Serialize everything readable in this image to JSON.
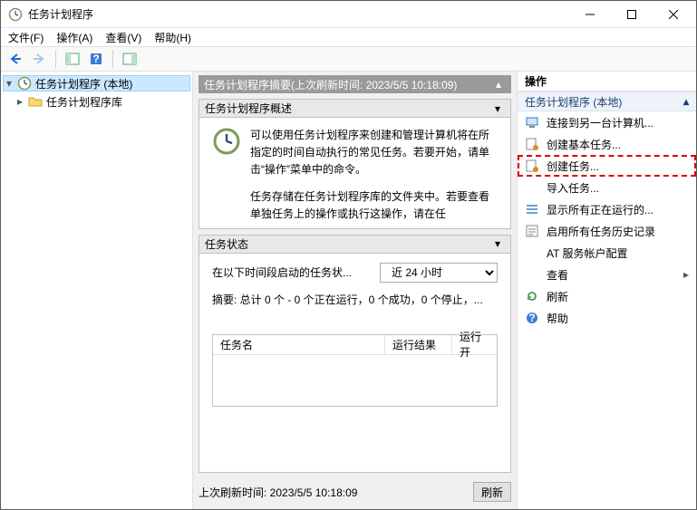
{
  "window": {
    "title": "任务计划程序"
  },
  "menu": {
    "file": "文件(F)",
    "action": "操作(A)",
    "view": "查看(V)",
    "help": "帮助(H)"
  },
  "tree": {
    "root": "任务计划程序 (本地)",
    "child": "任务计划程序库"
  },
  "summary": {
    "header": "任务计划程序摘要(上次刷新时间: 2023/5/5 10:18:09)",
    "overview_title": "任务计划程序概述",
    "overview_body": "可以使用任务计划程序来创建和管理计算机将在所指定的时间自动执行的常见任务。若要开始，请单击“操作”菜单中的命令。",
    "overview_body2": "任务存储在任务计划程序库的文件夹中。若要查看单独任务上的操作或执行这操作，请在任"
  },
  "status": {
    "title": "任务状态",
    "range_label": "在以下时间段启动的任务状...",
    "range_value": "近 24 小时",
    "summary_line": "摘要: 总计 0 个 - 0 个正在运行，0 个成功，0 个停止，...",
    "col1": "任务名",
    "col2": "运行结果",
    "col3": "运行开"
  },
  "last_refresh": {
    "label": "上次刷新时间: 2023/5/5 10:18:09",
    "btn": "刷新"
  },
  "actions": {
    "pane_title": "操作",
    "group": "任务计划程序 (本地)",
    "items": [
      "连接到另一台计算机...",
      "创建基本任务...",
      "创建任务...",
      "导入任务...",
      "显示所有正在运行的...",
      "启用所有任务历史记录",
      "AT 服务帐户配置",
      "查看",
      "刷新",
      "帮助"
    ]
  }
}
